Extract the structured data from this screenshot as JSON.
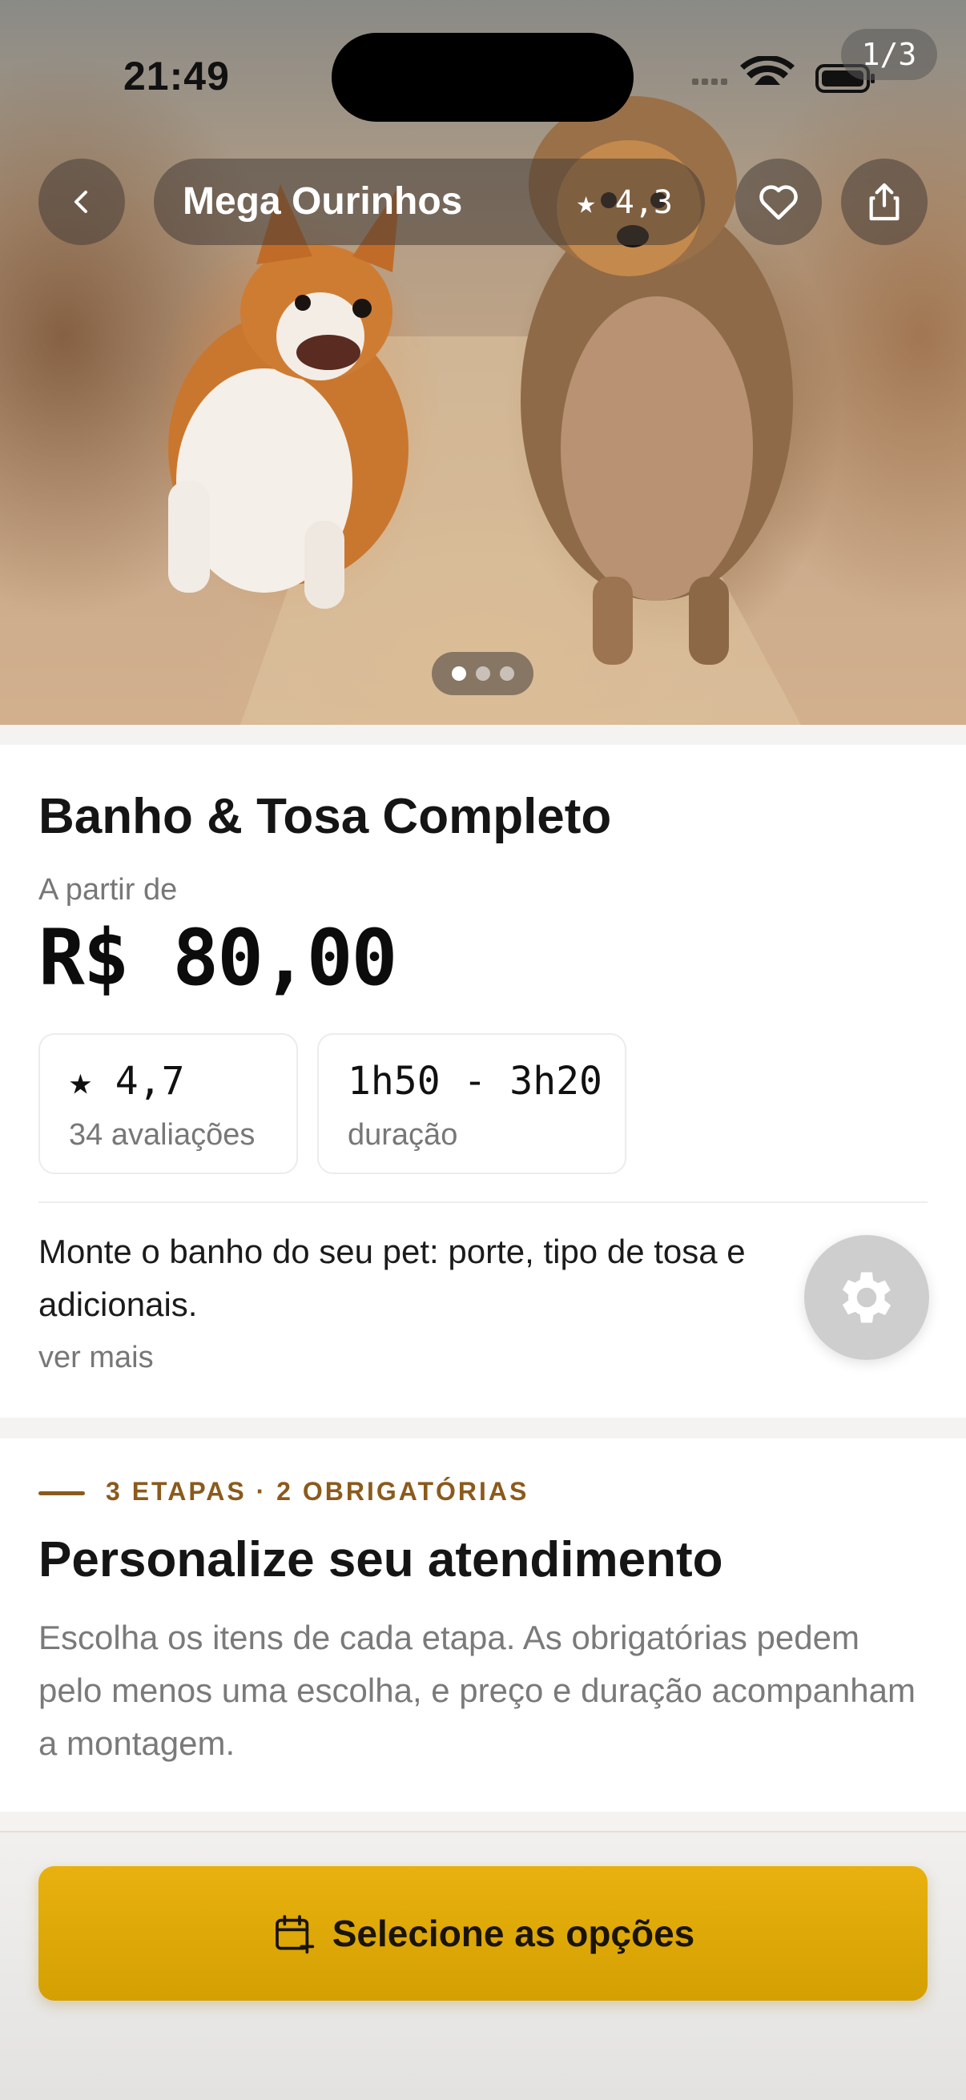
{
  "status_bar": {
    "time": "21:49"
  },
  "gallery": {
    "counter": "1/3",
    "total_images": 3,
    "active_index": 0
  },
  "header": {
    "store_name": "Mega Ourinhos",
    "store_rating": "★ 4,3"
  },
  "service": {
    "title": "Banho & Tosa Completo",
    "from_label": "A partir de",
    "price": "R$ 80,00",
    "rating_value": "★ 4,7",
    "rating_label": "34 avaliações",
    "duration_value": "1h50 - 3h20",
    "duration_label": "duração",
    "description": "Monte o banho do seu pet: porte, tipo de tosa e adicionais.",
    "see_more": "ver mais"
  },
  "customize": {
    "eyebrow": "3 ETAPAS · 2 OBRIGATÓRIAS",
    "title": "Personalize seu atendimento",
    "text": "Escolha os itens de cada etapa. As obrigatórias pedem pelo menos uma escolha, e preço e duração acompanham a montagem."
  },
  "cta": {
    "label": "Selecione as opções"
  },
  "colors": {
    "accent": "#e0aa08",
    "eyebrow": "#8b5a1c",
    "muted": "#777777"
  },
  "icons": [
    "back-icon",
    "heart-icon",
    "share-icon",
    "gear-icon",
    "calendar-plus-icon",
    "wifi-icon",
    "battery-icon",
    "signal-icon"
  ]
}
